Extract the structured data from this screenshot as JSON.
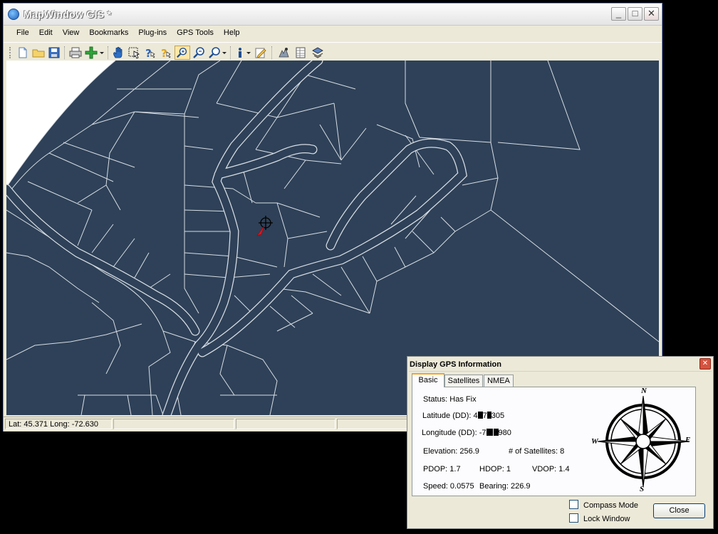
{
  "window": {
    "title": "MapWindow GIS *",
    "min_glyph": "_",
    "max_glyph": "□",
    "close_glyph": "✕"
  },
  "menu": [
    "File",
    "Edit",
    "View",
    "Bookmarks",
    "Plug-ins",
    "GPS Tools",
    "Help"
  ],
  "toolbar_icons": [
    "new-icon",
    "open-folder-icon",
    "save-icon",
    "print-icon",
    "add-layer-icon",
    "pan-hand-icon",
    "select-icon",
    "identify-icon",
    "help-icon",
    "zoom-in-icon",
    "zoom-out-icon",
    "zoom-extent-icon",
    "info-icon",
    "edit-icon",
    "gps-icon",
    "table-icon",
    "layers-icon"
  ],
  "status": {
    "coords": "Lat: 45.371 Long: -72.630"
  },
  "gps_dialog": {
    "title": "Display GPS Information",
    "close_glyph": "✕",
    "tabs": [
      "Basic",
      "Satellites",
      "NMEA"
    ],
    "active_tab": "Basic",
    "status": "Status: Has Fix",
    "latitude_label": "Latitude (DD): ",
    "latitude_pre": "4",
    "latitude_mid": "7",
    "latitude_post": "305",
    "longitude_label": "Longitude (DD): ",
    "longitude_pre": "-7",
    "longitude_post": "980",
    "elevation": "Elevation: 256.9",
    "satellites": "# of Satellites: 8",
    "pdop": "PDOP: 1.7",
    "hdop": "HDOP: 1",
    "vdop": "VDOP: 1.4",
    "speed": "Speed: 0.0575",
    "bearing": "Bearing: 226.9",
    "compass_n": "N",
    "compass_s": "S",
    "compass_e": "E",
    "compass_w": "W",
    "compass_mode_label": "Compass Mode",
    "lock_window_label": "Lock Window",
    "close_button": "Close"
  },
  "colors": {
    "map_background": "#2e4158",
    "map_lines": "#d8dde4",
    "gps_marker": "#e0141e"
  }
}
